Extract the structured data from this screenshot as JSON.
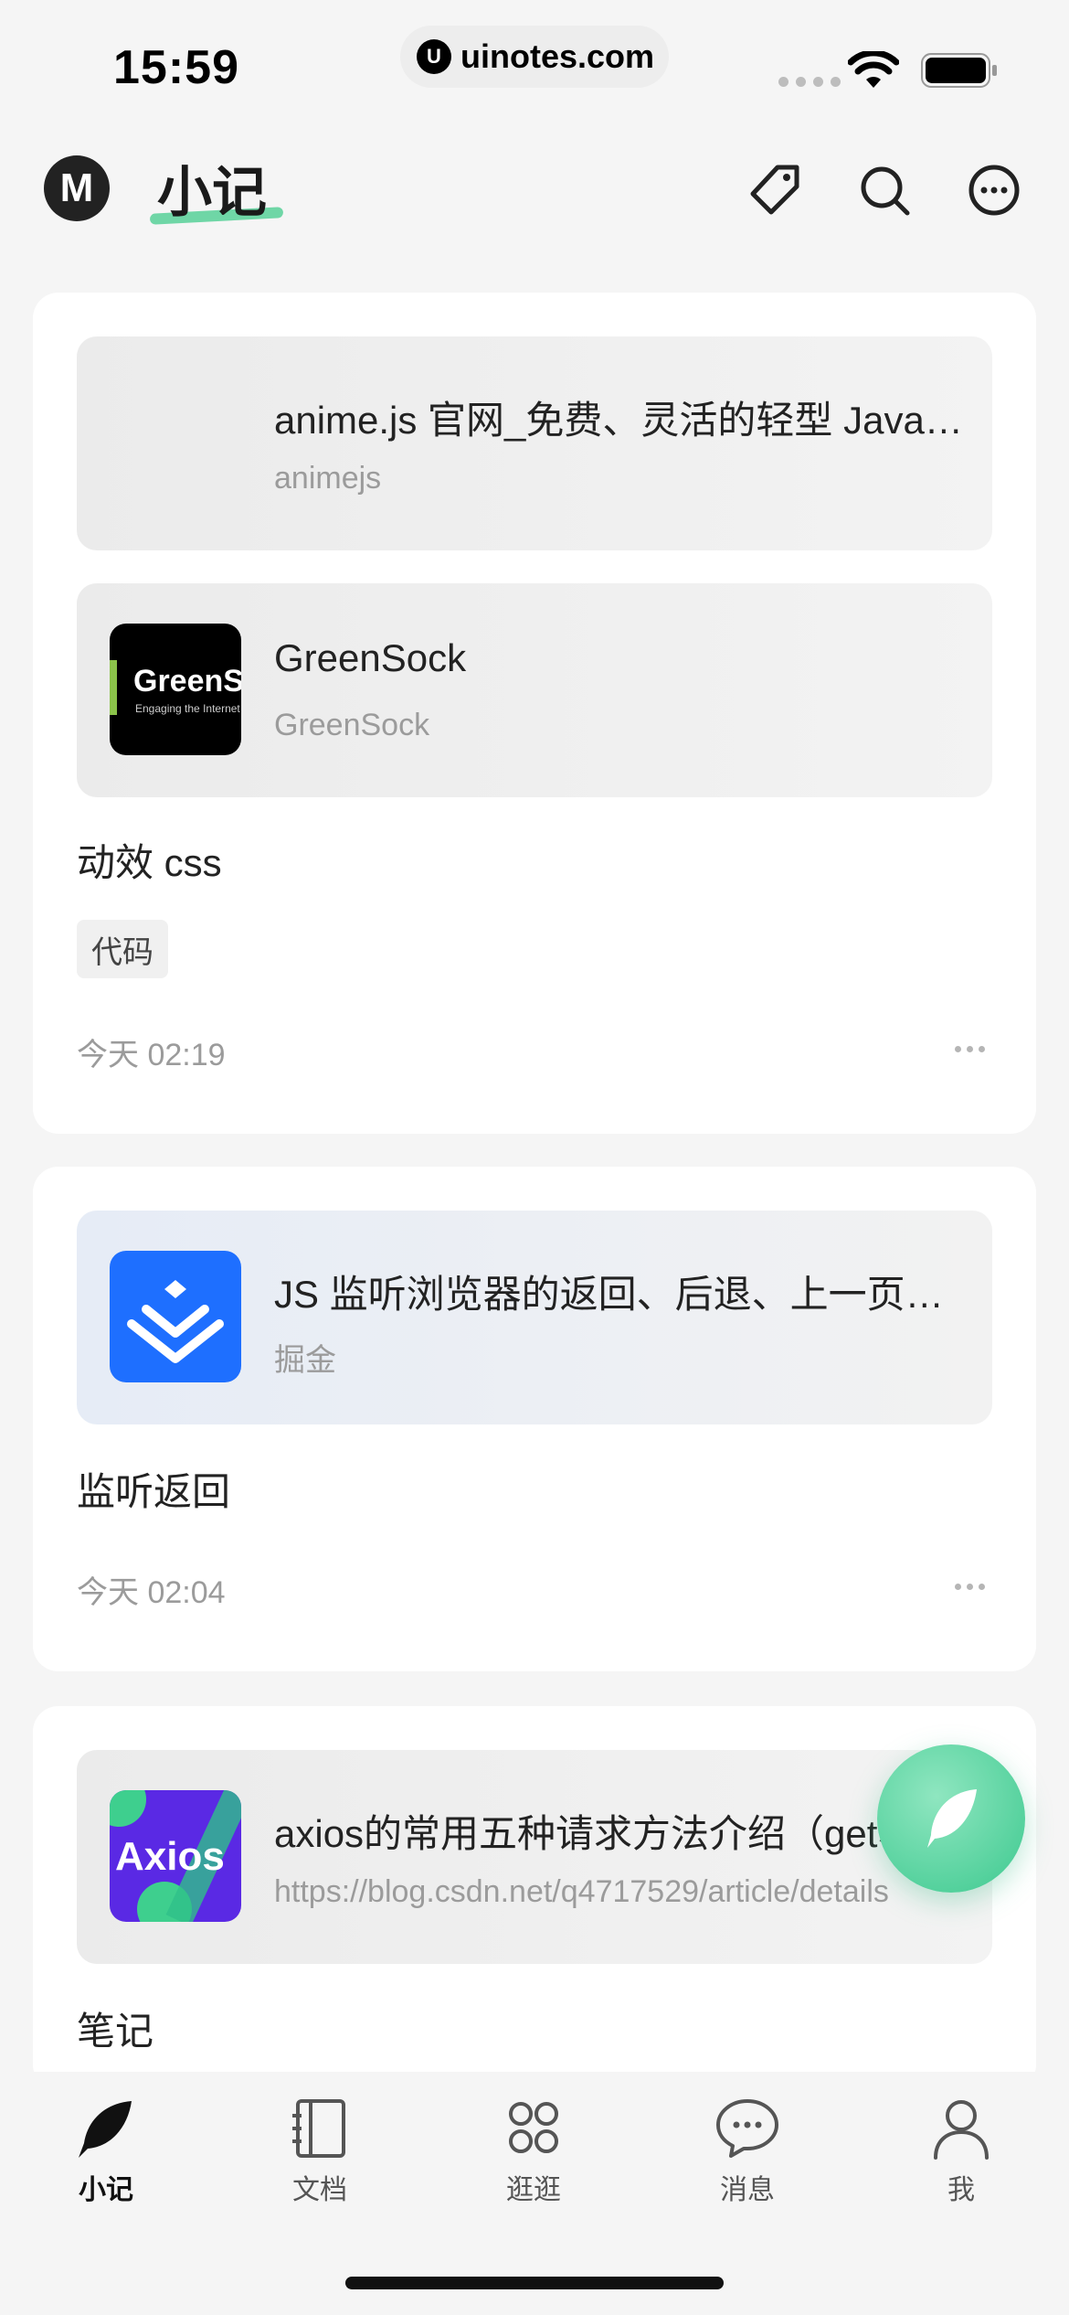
{
  "status": {
    "time": "15:59",
    "url": "uinotes.com",
    "url_logo": "U"
  },
  "header": {
    "title": "小记",
    "logo_letter": "M"
  },
  "notes": [
    {
      "links": [
        {
          "title": "anime.js 官网_免费、灵活的轻型 JavaScript 动画库",
          "source": "animejs"
        },
        {
          "title": "GreenSock",
          "source": "GreenSock",
          "thumb_text": "GreenSock",
          "thumb_sub": "Engaging the Internet"
        }
      ],
      "text": "动效 css",
      "tag": "代码",
      "time": "今天 02:19"
    },
    {
      "links": [
        {
          "title": "JS 监听浏览器的返回、后退、上一页操作",
          "source": "掘金"
        }
      ],
      "text": "监听返回",
      "time": "今天 02:04"
    },
    {
      "links": [
        {
          "title": "axios的常用五种请求方法介绍（get、post）",
          "source": "https://blog.csdn.net/q4717529/article/details",
          "thumb_text": "Axios"
        }
      ],
      "text": "笔记"
    }
  ],
  "tabbar": {
    "items": [
      {
        "label": "小记",
        "icon": "quill-icon",
        "active": true
      },
      {
        "label": "文档",
        "icon": "notebook-icon"
      },
      {
        "label": "逛逛",
        "icon": "grid-icon"
      },
      {
        "label": "消息",
        "icon": "chat-icon"
      },
      {
        "label": "我",
        "icon": "person-icon"
      }
    ]
  },
  "colors": {
    "accent": "#6fd6a6",
    "fab": "#3dc98f",
    "juejin": "#1e6fff",
    "axios": "#5a29e4"
  }
}
